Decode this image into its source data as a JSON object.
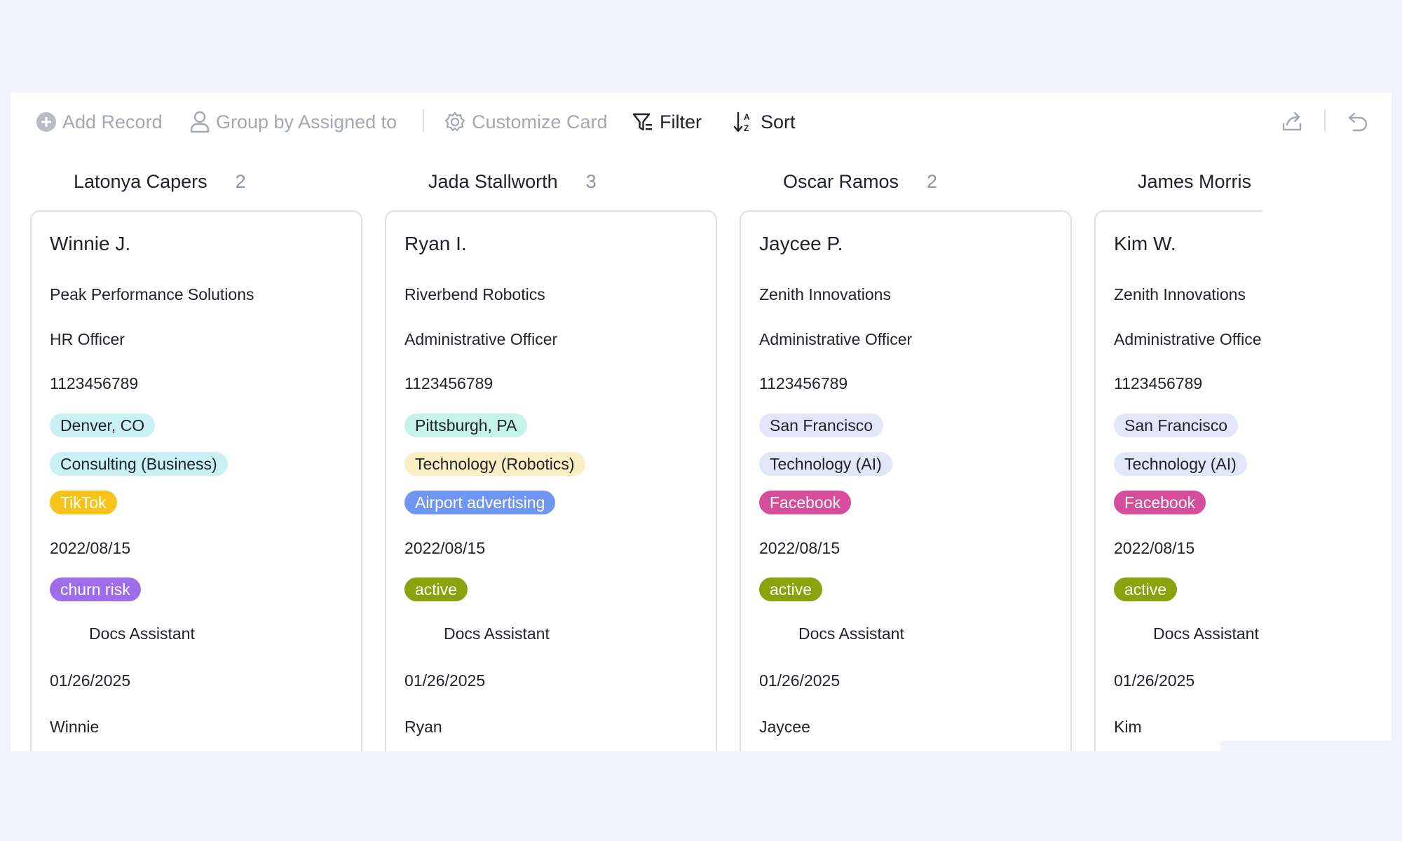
{
  "toolbar": {
    "add_record": "Add Record",
    "group_by": "Group by Assigned to",
    "customize_card": "Customize Card",
    "filter": "Filter",
    "sort": "Sort"
  },
  "columns": [
    {
      "name": "Latonya Capers",
      "count": "2"
    },
    {
      "name": "Jada Stallworth",
      "count": "3"
    },
    {
      "name": "Oscar Ramos",
      "count": "2"
    },
    {
      "name": "James Morris",
      "count": ""
    }
  ],
  "cards": [
    {
      "name": "Winnie J.",
      "company": "Peak Performance Solutions",
      "title": "HR Officer",
      "phone": "1123456789",
      "location": "Denver, CO",
      "industry": "Consulting (Business)",
      "channel": "TikTok",
      "date1": "2022/08/15",
      "status": "churn risk",
      "assistant": "Docs Assistant",
      "date2": "01/26/2025",
      "first_name": "Winnie"
    },
    {
      "name": "Ryan I.",
      "company": "Riverbend Robotics",
      "title": "Administrative Officer",
      "phone": "1123456789",
      "location": "Pittsburgh, PA",
      "industry": "Technology (Robotics)",
      "channel": "Airport advertising",
      "date1": "2022/08/15",
      "status": "active",
      "assistant": "Docs Assistant",
      "date2": "01/26/2025",
      "first_name": "Ryan"
    },
    {
      "name": "Jaycee P.",
      "company": "Zenith Innovations",
      "title": "Administrative Officer",
      "phone": "1123456789",
      "location": "San Francisco",
      "industry": "Technology (AI)",
      "channel": "Facebook",
      "date1": "2022/08/15",
      "status": "active",
      "assistant": "Docs Assistant",
      "date2": "01/26/2025",
      "first_name": "Jaycee"
    },
    {
      "name": "Kim W.",
      "company": "Zenith Innovations",
      "title": "Administrative Officer",
      "phone": "1123456789",
      "location": "San Francisco",
      "industry": "Technology (AI)",
      "channel": "Facebook",
      "date1": "2022/08/15",
      "status": "active",
      "assistant": "Docs Assistant",
      "date2": "01/26/2025",
      "first_name": "Kim"
    }
  ],
  "colors": {
    "location_denver": "#c8f0f5",
    "industry_consulting": "#c8f0f5",
    "location_pittsburgh": "#c6f3e8",
    "industry_robotics": "#fbeec2",
    "location_sf": "#e1e6f8",
    "industry_ai": "#e1e6f8",
    "channel_tiktok": "#f7c31a",
    "channel_airport": "#6f96f2",
    "channel_facebook": "#d64d9b",
    "status_churn": "#9f6cec",
    "status_active": "#8aa20b"
  },
  "icons": {
    "add_record": "plus-circle-icon",
    "group_by": "person-icon",
    "customize_card": "gear-icon",
    "filter": "filter-icon",
    "sort": "sort-icon",
    "share": "share-icon",
    "undo": "undo-icon"
  }
}
